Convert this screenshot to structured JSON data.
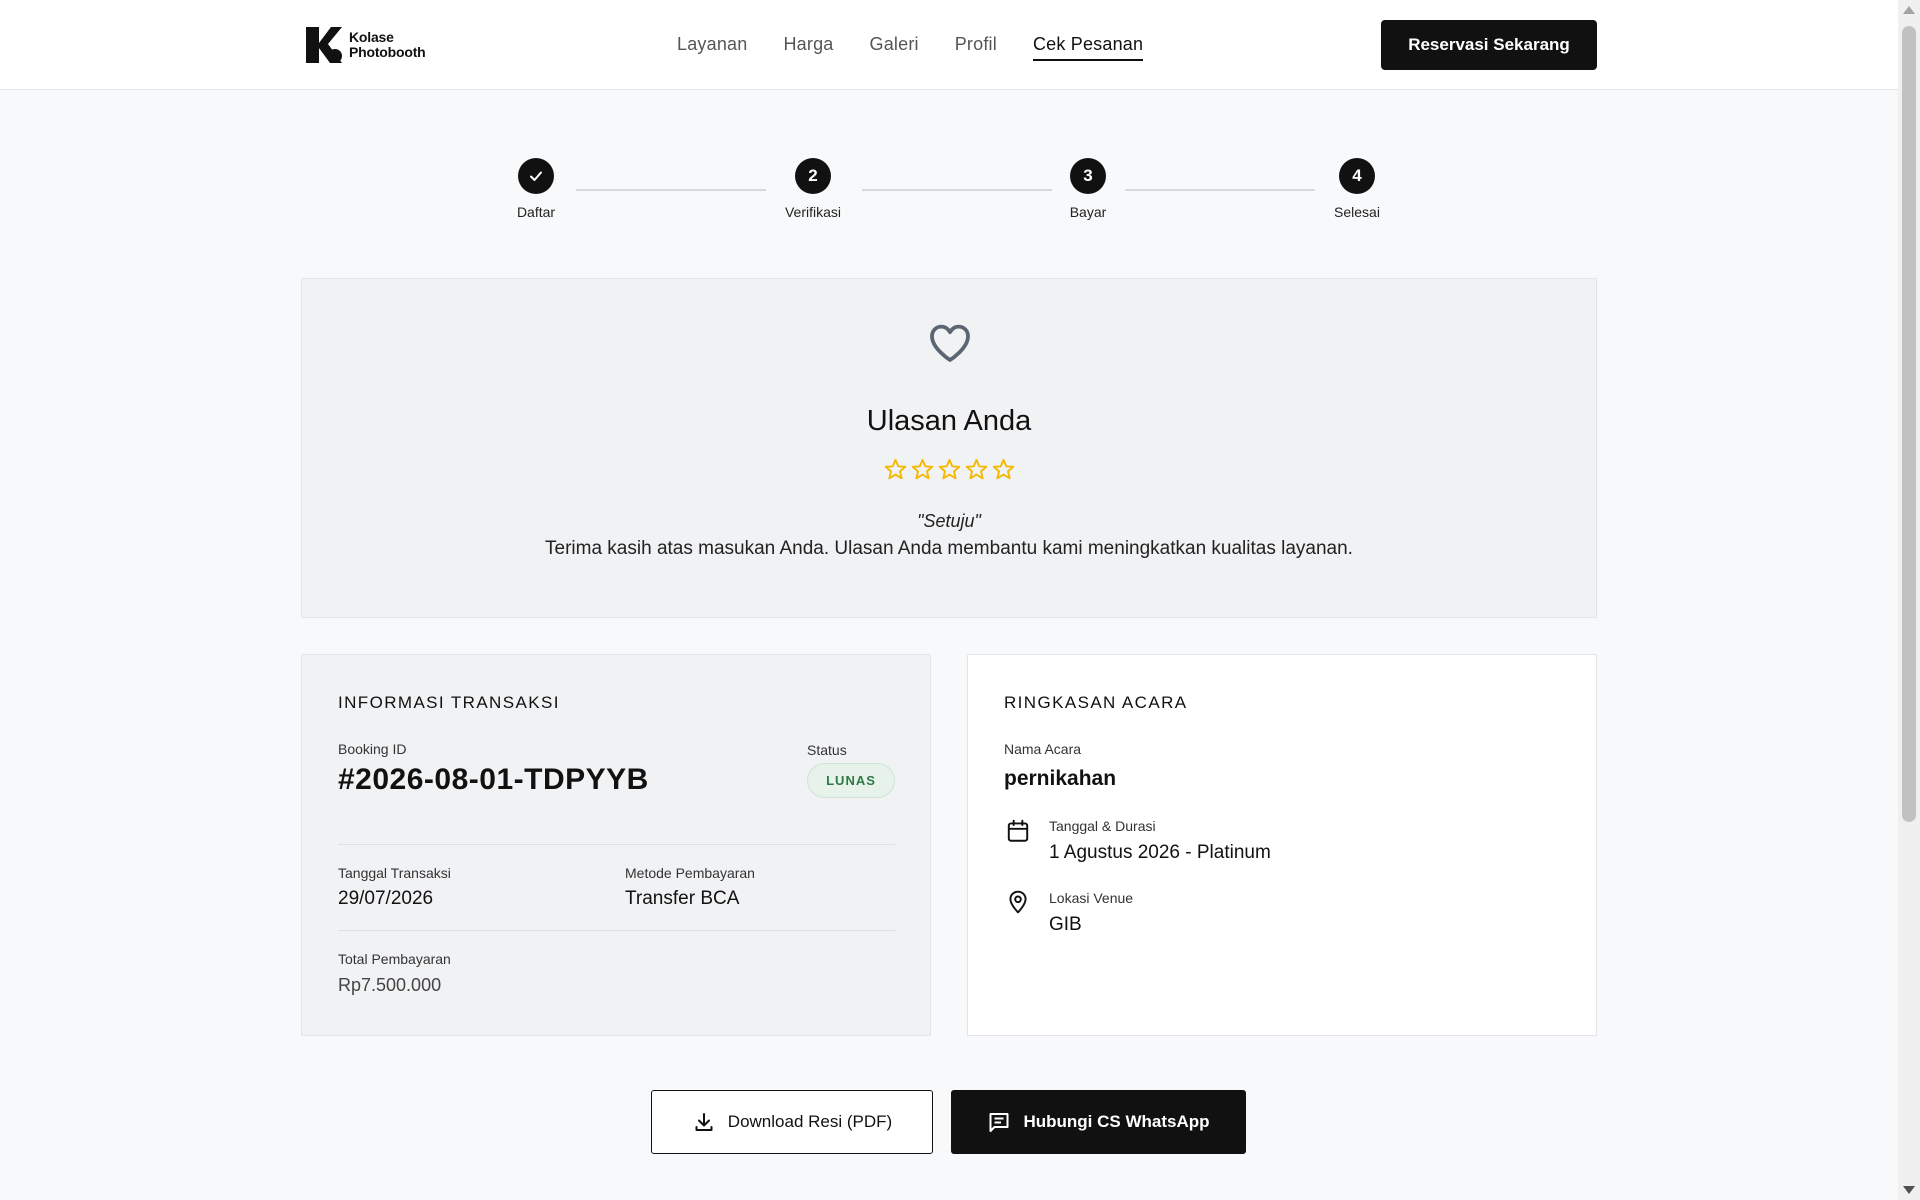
{
  "brand": {
    "name_line1": "Kolase",
    "name_line2": "Photobooth",
    "logo_icon": "k-logo-icon"
  },
  "nav": {
    "items": [
      {
        "label": "Layanan",
        "active": false
      },
      {
        "label": "Harga",
        "active": false
      },
      {
        "label": "Galeri",
        "active": false
      },
      {
        "label": "Profil",
        "active": false
      },
      {
        "label": "Cek Pesanan",
        "active": true
      }
    ],
    "cta_label": "Reservasi Sekarang"
  },
  "stepper": {
    "steps": [
      {
        "marker": "check-icon",
        "label": "Daftar"
      },
      {
        "marker": "2",
        "label": "Verifikasi"
      },
      {
        "marker": "3",
        "label": "Bayar"
      },
      {
        "marker": "4",
        "label": "Selesai"
      }
    ]
  },
  "review": {
    "icon": "heart-icon",
    "title": "Ulasan Anda",
    "rating": 0,
    "max_rating": 5,
    "quote": "\"Setuju\"",
    "thanks": "Terima kasih atas masukan Anda. Ulasan Anda membantu kami meningkatkan kualitas layanan.",
    "star_color": "#f5b800"
  },
  "transaction": {
    "title": "INFORMASI TRANSAKSI",
    "booking_id_label": "Booking ID",
    "booking_id": "#2026-08-01-TDPYYB",
    "status_label": "Status",
    "status": "LUNAS",
    "date_label": "Tanggal Transaksi",
    "date": "29/07/2026",
    "method_label": "Metode Pembayaran",
    "method": "Transfer BCA",
    "total_label": "Total Pembayaran",
    "total": "Rp7.500.000"
  },
  "event": {
    "title": "RINGKASAN ACARA",
    "name_label": "Nama Acara",
    "name": "pernikahan",
    "date_label": "Tanggal & Durasi",
    "date": "1 Agustus 2026 - Platinum",
    "date_icon": "calendar-icon",
    "venue_label": "Lokasi Venue",
    "venue": "GIB",
    "venue_icon": "location-pin-icon"
  },
  "actions": {
    "download_label": "Download Resi (PDF)",
    "download_icon": "download-icon",
    "whatsapp_label": "Hubungi CS WhatsApp",
    "whatsapp_icon": "chat-icon"
  },
  "colors": {
    "primary": "#111111",
    "status_green": "#2f7a44",
    "status_bg": "#e6f2ea",
    "page_bg": "#f8f9fa"
  }
}
